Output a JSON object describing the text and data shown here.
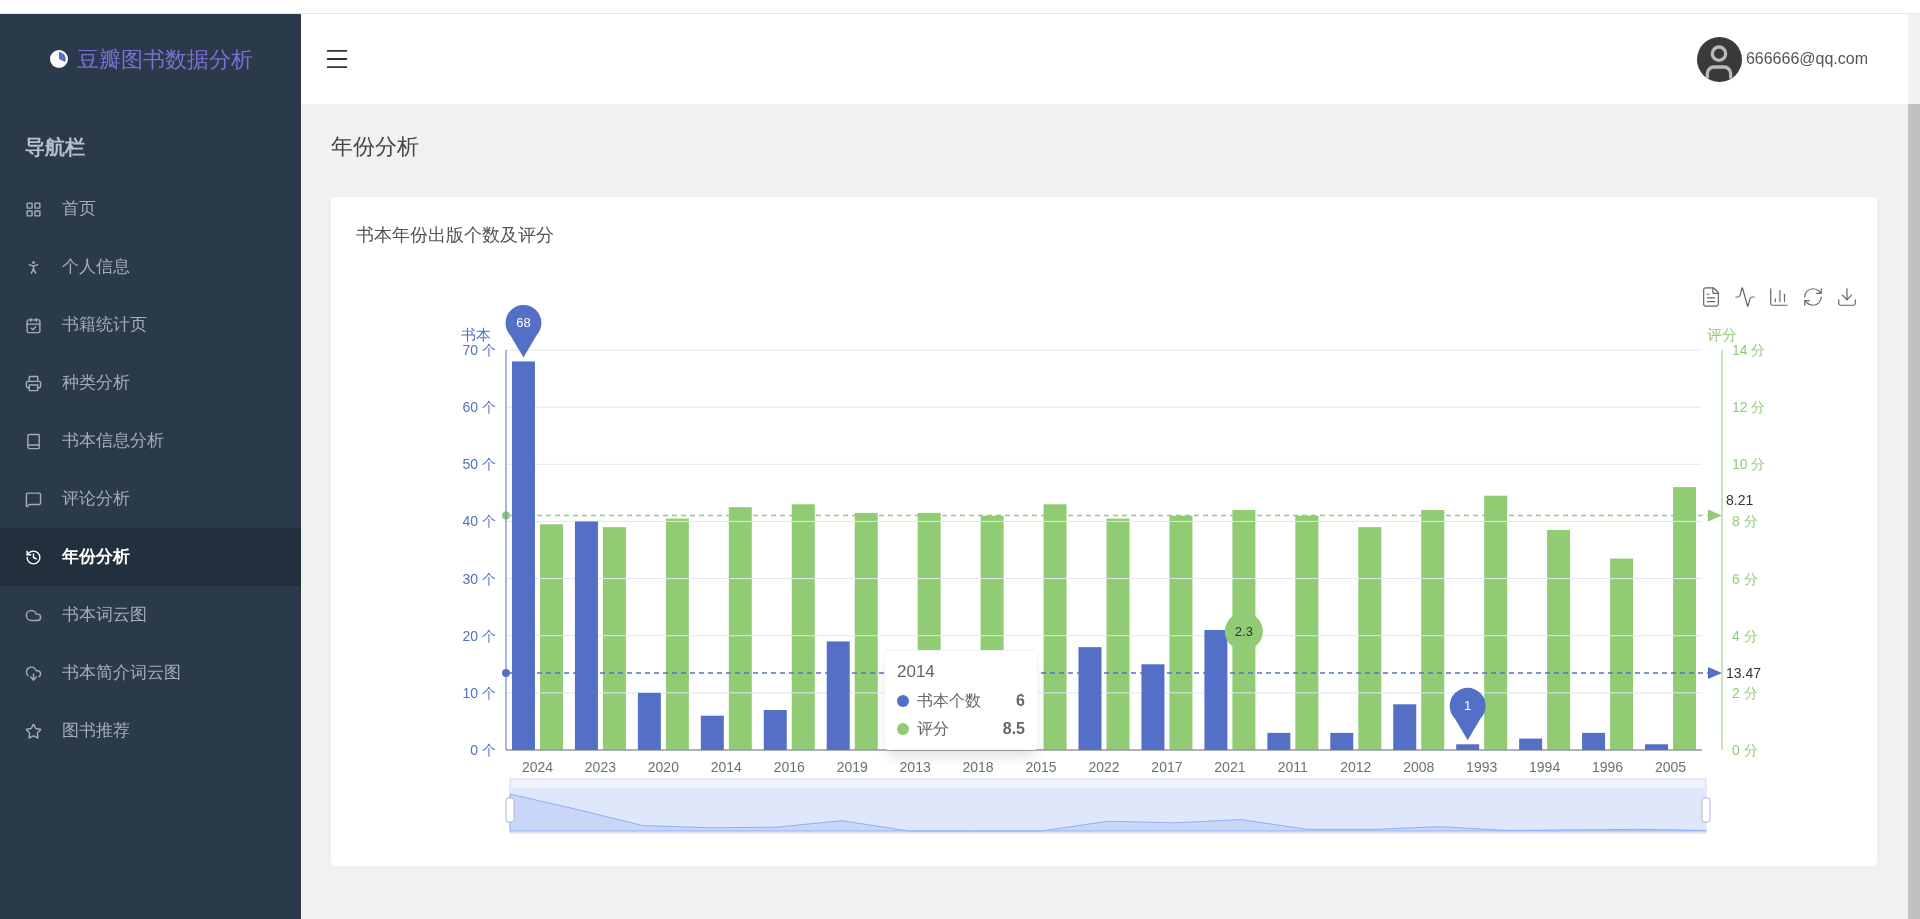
{
  "sidebar": {
    "brand": "豆瓣图书数据分析",
    "heading": "导航栏",
    "items": [
      {
        "label": "首页",
        "selected": false
      },
      {
        "label": "个人信息",
        "selected": false
      },
      {
        "label": "书籍统计页",
        "selected": false
      },
      {
        "label": "种类分析",
        "selected": false
      },
      {
        "label": "书本信息分析",
        "selected": false
      },
      {
        "label": "评论分析",
        "selected": false
      },
      {
        "label": "年份分析",
        "selected": true
      },
      {
        "label": "书本词云图",
        "selected": false
      },
      {
        "label": "书本简介词云图",
        "selected": false
      },
      {
        "label": "图书推荐",
        "selected": false
      }
    ]
  },
  "header": {
    "user": "666666@qq.com"
  },
  "page_title": "年份分析",
  "card": {
    "title": "书本年份出版个数及评分",
    "count_axis": {
      "chart_data": {
        "type": "bar",
        "ylabel": "书本",
        "grid": true,
        "categories": [
          "2024",
          "2023",
          "2020",
          "2014",
          "2016",
          "2019",
          "2013",
          "2018",
          "2015",
          "2022",
          "2017",
          "2021",
          "2011",
          "2012",
          "2008",
          "1993",
          "1994",
          "1996",
          "2005"
        ],
        "series": [
          {
            "color": "#5470c6",
            "values": [
              68,
              40,
              10,
              6,
              7,
              19,
              null,
              null,
              null,
              18,
              15,
              21,
              3,
              3,
              8,
              1,
              2,
              3,
              1
            ]
          }
        ],
        "ylim": [
          0,
          70
        ],
        "yticks": [
          {
            "value": 0,
            "label": "0 个"
          },
          {
            "value": 10,
            "label": "10 个"
          },
          {
            "value": 20,
            "label": "20 个"
          },
          {
            "value": 30,
            "label": "30 个"
          },
          {
            "value": 40,
            "label": "40 个"
          },
          {
            "value": 50,
            "label": "50 个"
          },
          {
            "value": 60,
            "label": "60 个"
          },
          {
            "value": 70,
            "label": "70 个"
          }
        ],
        "annotations": [
          {
            "text": "68",
            "x": "2024",
            "y": 68
          },
          {
            "text": "1",
            "x": "1993",
            "y": 1
          },
          {
            "text": "2.3",
            "x": "2021",
            "y": 20.75
          }
        ],
        "ref_lines": [
          {
            "axis": "y",
            "value": 13.47,
            "label": "13.47"
          }
        ]
      }
    },
    "score_axis": {
      "chart_data": {
        "type": "bar",
        "ylabel": "评分",
        "series": [
          {
            "color": "#91cc75",
            "values": [
              7.9,
              7.8,
              8.1,
              8.5,
              8.6,
              8.3,
              8.3,
              8.2,
              8.6,
              8.1,
              8.2,
              8.4,
              8.2,
              7.8,
              8.4,
              8.9,
              7.7,
              6.7,
              9.2
            ]
          }
        ],
        "ylim": [
          0,
          14
        ],
        "yticks": [
          {
            "value": 0,
            "label": "0 分"
          },
          {
            "value": 2,
            "label": "2 分"
          },
          {
            "value": 4,
            "label": "4 分"
          },
          {
            "value": 6,
            "label": "6 分"
          },
          {
            "value": 8,
            "label": "8 分"
          },
          {
            "value": 10,
            "label": "10 分"
          },
          {
            "value": 12,
            "label": "12 分"
          },
          {
            "value": 14,
            "label": "14 分"
          }
        ],
        "ref_lines": [
          {
            "axis": "y",
            "value": 8.21,
            "label": "8.21"
          }
        ]
      }
    },
    "zoom_slider": {
      "level": 1
    },
    "tooltip": {
      "title": "2014",
      "rows": [
        {
          "name": "书本个数",
          "value": "6",
          "color": "#5470c6"
        },
        {
          "name": "评分",
          "value": "8.5",
          "color": "#91cc75"
        }
      ]
    }
  }
}
